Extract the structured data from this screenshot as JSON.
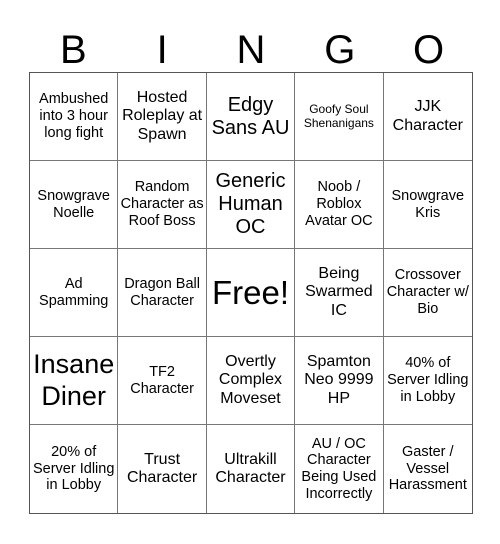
{
  "header": {
    "letters": [
      "B",
      "I",
      "N",
      "G",
      "O"
    ]
  },
  "cells": [
    {
      "text": "Ambushed into 3 hour long fight",
      "size": "s-sm"
    },
    {
      "text": "Hosted Roleplay at Spawn",
      "size": "s-md"
    },
    {
      "text": "Edgy Sans AU",
      "size": "s-lg"
    },
    {
      "text": "Goofy Soul Shenanigans",
      "size": "s-xs"
    },
    {
      "text": "JJK Character",
      "size": "s-md"
    },
    {
      "text": "Snowgrave Noelle",
      "size": "s-sm"
    },
    {
      "text": "Random Character as Roof Boss",
      "size": "s-sm"
    },
    {
      "text": "Generic Human OC",
      "size": "s-lg"
    },
    {
      "text": "Noob / Roblox Avatar OC",
      "size": "s-sm"
    },
    {
      "text": "Snowgrave Kris",
      "size": "s-sm"
    },
    {
      "text": "Ad Spamming",
      "size": "s-sm"
    },
    {
      "text": "Dragon Ball Character",
      "size": "s-sm"
    },
    {
      "text": "Free!",
      "size": "s-xxl"
    },
    {
      "text": "Being Swarmed IC",
      "size": "s-md"
    },
    {
      "text": "Crossover Character w/ Bio",
      "size": "s-sm"
    },
    {
      "text": "Insane Diner",
      "size": "s-xl"
    },
    {
      "text": "TF2 Character",
      "size": "s-sm"
    },
    {
      "text": "Overtly Complex Moveset",
      "size": "s-md"
    },
    {
      "text": "Spamton Neo 9999 HP",
      "size": "s-md"
    },
    {
      "text": "40% of Server Idling in Lobby",
      "size": "s-sm"
    },
    {
      "text": "20% of Server Idling in Lobby",
      "size": "s-sm"
    },
    {
      "text": "Trust Character",
      "size": "s-md"
    },
    {
      "text": "Ultrakill Character",
      "size": "s-md"
    },
    {
      "text": "AU / OC Character Being Used Incorrectly",
      "size": "s-sm"
    },
    {
      "text": "Gaster / Vessel Harassment",
      "size": "s-sm"
    }
  ]
}
